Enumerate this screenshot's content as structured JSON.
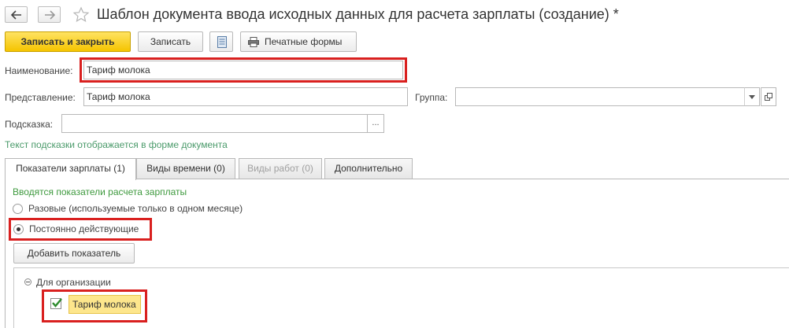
{
  "window": {
    "title": "Шаблон документа ввода исходных данных для расчета зарплаты (создание) *"
  },
  "toolbar": {
    "save_close_label": "Записать и закрыть",
    "save_label": "Записать",
    "print_forms_label": "Печатные формы"
  },
  "form": {
    "name_label": "Наименование:",
    "name_value": "Тариф молока",
    "presentation_label": "Представление:",
    "presentation_value": "Тариф молока",
    "group_label": "Группа:",
    "group_value": "",
    "tooltip_label": "Подсказка:",
    "tooltip_value": "",
    "tooltip_hint": "Текст подсказки отображается в форме документа",
    "ellipsis": "..."
  },
  "tabs": [
    {
      "label": "Показатели зарплаты (1)"
    },
    {
      "label": "Виды времени (0)"
    },
    {
      "label": "Виды работ (0)"
    },
    {
      "label": "Дополнительно"
    }
  ],
  "panel": {
    "section_title": "Вводятся показатели расчета зарплаты",
    "radio_one_time": "Разовые (используемые только в одном месяце)",
    "radio_permanent": "Постоянно действующие",
    "add_indicator_label": "Добавить показатель",
    "tree_group": "Для организации",
    "tree_item": "Тариф молока",
    "tree_item_checked": true
  },
  "colors": {
    "primary_button": "#f5c400",
    "highlight_red": "#d9201f",
    "hint_green": "#4a9a6a",
    "selected_item_bg": "#fde68c"
  }
}
